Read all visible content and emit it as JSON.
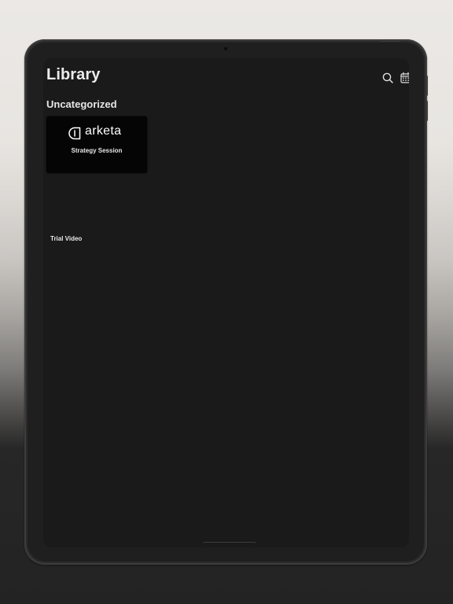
{
  "header": {
    "title": "Library"
  },
  "toolbar": {
    "search_icon": "search-icon",
    "calendar_icon": "calendar-icon"
  },
  "library": {
    "sections": [
      {
        "heading": "Uncategorized",
        "items": [
          {
            "label": "Trial Video",
            "thumbnail": {
              "logo_text": "arketa",
              "subtitle": "Strategy Session"
            }
          }
        ]
      }
    ]
  },
  "colors": {
    "screen_background": "#1b1a1a",
    "text_primary": "#ececec",
    "thumbnail_background": "#050505"
  }
}
